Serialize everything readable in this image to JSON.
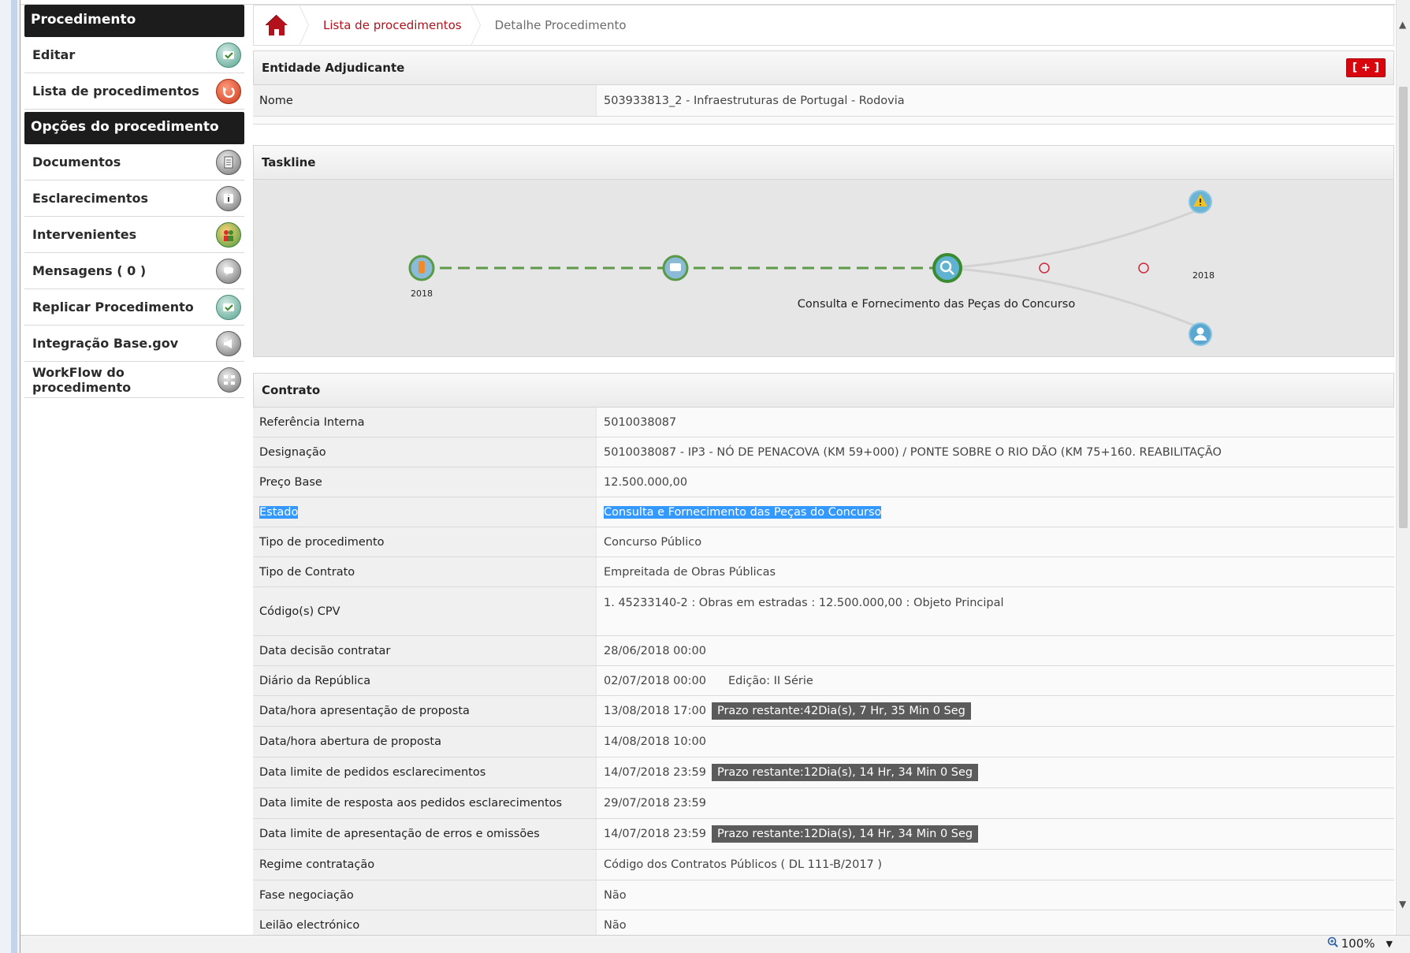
{
  "sidebar": {
    "header1": "Procedimento",
    "group1": [
      {
        "label": "Editar",
        "icon": "edit-icon"
      },
      {
        "label": "Lista de procedimentos",
        "icon": "back-icon"
      }
    ],
    "header2": "Opções do procedimento",
    "group2": [
      {
        "label": "Documentos",
        "icon": "documents-icon"
      },
      {
        "label": "Esclarecimentos",
        "icon": "info-icon"
      },
      {
        "label": "Intervenientes",
        "icon": "people-icon"
      },
      {
        "label": "Mensagens ( 0 )",
        "icon": "message-icon"
      },
      {
        "label": "Replicar Procedimento",
        "icon": "replicate-icon"
      },
      {
        "label": "Integração Base.gov",
        "icon": "megaphone-icon"
      },
      {
        "label": "WorkFlow do procedimento",
        "icon": "workflow-icon"
      }
    ]
  },
  "breadcrumb": {
    "link": "Lista de procedimentos",
    "current": "Detalhe Procedimento"
  },
  "entidade": {
    "title": "Entidade Adjudicante",
    "expand": "[ + ]",
    "nome_label": "Nome",
    "nome_value": "503933813_2 - Infraestruturas de Portugal - Rodovia"
  },
  "taskline": {
    "title": "Taskline",
    "year_left": "2018",
    "year_right": "2018",
    "current_label": "Consulta e Fornecimento das Peças do Concurso"
  },
  "contrato": {
    "title": "Contrato",
    "rows": [
      {
        "label": "Referência Interna",
        "value": "5010038087"
      },
      {
        "label": "Designação",
        "value": "5010038087 - IP3 - NÓ DE PENACOVA (KM 59+000) / PONTE SOBRE O RIO DÃO (KM 75+160. REABILITAÇÃO"
      },
      {
        "label": "Preço Base",
        "value": "12.500.000,00"
      },
      {
        "label": "Estado",
        "value": "Consulta e Fornecimento das Peças do Concurso"
      },
      {
        "label": "Tipo de procedimento",
        "value": "Concurso Público"
      },
      {
        "label": "Tipo de Contrato",
        "value": "Empreitada de Obras Públicas"
      },
      {
        "label": "Código(s) CPV",
        "value": "1.  45233140-2 : Obras em estradas : 12.500.000,00 : Objeto Principal"
      },
      {
        "label": "Data decisão contratar",
        "value": "28/06/2018 00:00"
      },
      {
        "label": "Diário da República",
        "value": "02/07/2018 00:00",
        "extra": "Edição: II Série"
      },
      {
        "label": "Data/hora apresentação de proposta",
        "value": "13/08/2018 17:00",
        "badge": "Prazo restante:42Dia(s), 7 Hr, 35 Min 0 Seg"
      },
      {
        "label": "Data/hora abertura de proposta",
        "value": "14/08/2018 10:00"
      },
      {
        "label": "Data limite de pedidos esclarecimentos",
        "value": "14/07/2018 23:59",
        "badge": "Prazo restante:12Dia(s), 14 Hr, 34 Min 0 Seg"
      },
      {
        "label": "Data limite de resposta aos pedidos esclarecimentos",
        "value": "29/07/2018 23:59"
      },
      {
        "label": "Data limite de apresentação de erros e omissões",
        "value": "14/07/2018 23:59",
        "badge": "Prazo restante:12Dia(s), 14 Hr, 34 Min 0 Seg"
      },
      {
        "label": "Regime contratação",
        "value": "Código dos Contratos Públicos ( DL 111-B/2017 )"
      },
      {
        "label": "Fase negociação",
        "value": "Não"
      },
      {
        "label": "Leilão electrónico",
        "value": "Não"
      }
    ]
  },
  "status": {
    "zoom": "100%"
  },
  "colors": {
    "brand_red": "#b3121c",
    "dark_header": "#1c1c1c",
    "badge": "#5b5b5b",
    "selection": "#3399ff",
    "taskline_dash": "#5e9a4a"
  }
}
